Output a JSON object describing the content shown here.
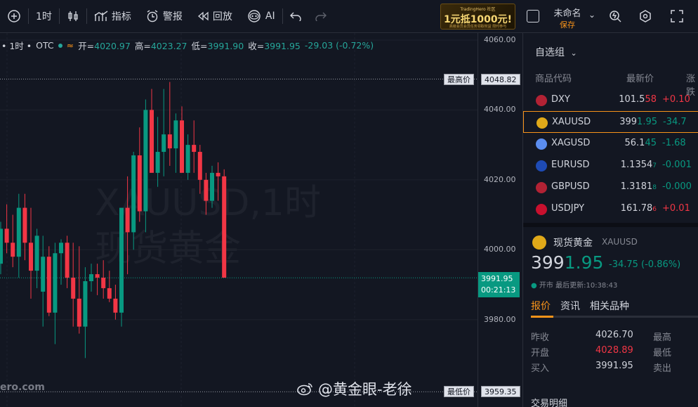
{
  "toolbar": {
    "interval": "1时",
    "indicators": "指标",
    "alerts": "警报",
    "replay": "回放",
    "ai": "AI",
    "layout_name": "未命名",
    "save": "保存",
    "ad": {
      "small": "TradingHero 社区",
      "big": "1元抵1000元!",
      "sub": "高级会员会员任务领取权益 限时参与"
    }
  },
  "chart": {
    "legend": {
      "interval": "1时",
      "exchange": "OTC",
      "open_label": "开=",
      "open": "4020.97",
      "high_label": "高=",
      "high": "4023.27",
      "low_label": "低=",
      "low": "3991.90",
      "close_label": "收=",
      "close": "3991.95",
      "change": "-29.03 (-0.72%)"
    },
    "watermark_line1": "XAUUSD,1时",
    "watermark_line2": "现货黄金",
    "brand": "ero.com",
    "colors": {
      "up": "#089981",
      "down": "#f23645",
      "grid": "#1e222d"
    }
  },
  "price_axis": {
    "ticks": [
      "4060.00",
      "4040.00",
      "4020.00",
      "4000.00",
      "3980.00"
    ],
    "max_label": "最高价",
    "max_value": "4048.82",
    "min_label": "最低价",
    "min_value": "3959.35",
    "current": "3991.95",
    "countdown": "00:21:13"
  },
  "chart_data": {
    "type": "candlestick",
    "candles": [
      [
        3996,
        4008,
        3993,
        4006
      ],
      [
        4006,
        4013,
        3999,
        4002
      ],
      [
        4002,
        4010,
        3995,
        3998
      ],
      [
        3998,
        4016,
        3992,
        4012
      ],
      [
        4012,
        4016,
        3997,
        4002
      ],
      [
        4002,
        4012,
        3986,
        3994
      ],
      [
        3994,
        4006,
        3989,
        4004
      ],
      [
        3988,
        4004,
        3978,
        3998
      ],
      [
        3998,
        4001,
        3981,
        3982
      ],
      [
        3982,
        4002,
        3973,
        3999
      ],
      [
        3999,
        4003,
        3990,
        4002
      ],
      [
        4002,
        4004,
        3989,
        3992
      ],
      [
        3992,
        4002,
        3978,
        3986
      ],
      [
        3986,
        4001,
        3976,
        3978
      ],
      [
        3978,
        3995,
        3969,
        3991
      ],
      [
        3991,
        3996,
        3988,
        3993
      ],
      [
        3993,
        3996,
        3987,
        3992
      ],
      [
        3992,
        3997,
        3986,
        3989
      ],
      [
        3989,
        3994,
        3985,
        3986
      ],
      [
        3986,
        3990,
        3980,
        3982
      ],
      [
        3982,
        4001,
        3978,
        4012
      ],
      [
        4012,
        4021,
        3993,
        4005
      ],
      [
        4005,
        4028,
        4000,
        4027
      ],
      [
        4027,
        4035,
        4008,
        4011
      ],
      [
        4011,
        4043,
        4005,
        4040
      ],
      [
        4040,
        4046,
        4025,
        4022
      ],
      [
        4022,
        4038,
        4018,
        4028
      ],
      [
        4028,
        4046,
        4021,
        4033
      ],
      [
        4033,
        4048,
        4024,
        4029
      ],
      [
        4029,
        4039,
        4022,
        4037
      ],
      [
        4037,
        4041,
        4026,
        4022
      ],
      [
        4022,
        4033,
        4020,
        4030
      ],
      [
        4030,
        4037,
        4022,
        4028
      ],
      [
        4028,
        4030,
        4016,
        4020
      ],
      [
        4020,
        4022,
        4010,
        4014
      ],
      [
        4014,
        4024,
        4012,
        4022
      ],
      [
        4022,
        4025,
        4014,
        4021
      ],
      [
        4021,
        4023,
        3992,
        3992
      ]
    ],
    "ylim": [
      3955,
      4062
    ]
  },
  "panel": {
    "watchlist_title": "自选组",
    "col_symbol": "商品代码",
    "col_last": "最新价",
    "col_change": "涨跌",
    "rows": [
      {
        "symbol": "DXY",
        "last_main": "101.5",
        "last_small": "58",
        "change": "+0.10",
        "dir": "up",
        "icon": "us-flag-icon",
        "icon_color": "#b22234"
      },
      {
        "symbol": "XAUUSD",
        "last_main": "399",
        "last_small": "1.95",
        "change": "-34.7",
        "dir": "down",
        "icon": "gold-icon",
        "icon_color": "#e0a919"
      },
      {
        "symbol": "XAGUSD",
        "last_main": "56.1",
        "last_small": "45",
        "change": "-1.68",
        "dir": "down",
        "icon": "silver-icon",
        "icon_color": "#5b8def"
      },
      {
        "symbol": "EURUSD",
        "last_main": "1.1354",
        "last_small": "7",
        "change": "-0.001",
        "dir": "down",
        "icon": "eu-flag-icon",
        "icon_color": "#1e4bb5"
      },
      {
        "symbol": "GBPUSD",
        "last_main": "1.3181",
        "last_small": "8",
        "change": "-0.000",
        "dir": "down",
        "icon": "uk-flag-icon",
        "icon_color": "#b22234"
      },
      {
        "symbol": "USDJPY",
        "last_main": "161.78",
        "last_small": "6",
        "change": "+0.01",
        "dir": "up",
        "icon": "jp-flag-icon",
        "icon_color": "#c8102e"
      }
    ],
    "detail": {
      "name": "现货黄金",
      "symbol": "XAUUSD",
      "price_main": "399",
      "price_small": "1.95",
      "change": "-34.75 (-0.86%)",
      "status": "开市 最后更新:10:38:43",
      "tabs": [
        "报价",
        "资讯",
        "相关品种"
      ],
      "stats": [
        {
          "label": "昨收",
          "value": "4026.70",
          "label2": "最高"
        },
        {
          "label": "开盘",
          "value": "4028.89",
          "label2": "最低",
          "red": true
        },
        {
          "label": "买入",
          "value": "3991.95",
          "label2": "卖出"
        }
      ],
      "trades_title": "交易明细"
    }
  },
  "watermark_text": "@黄金眼-老徐"
}
